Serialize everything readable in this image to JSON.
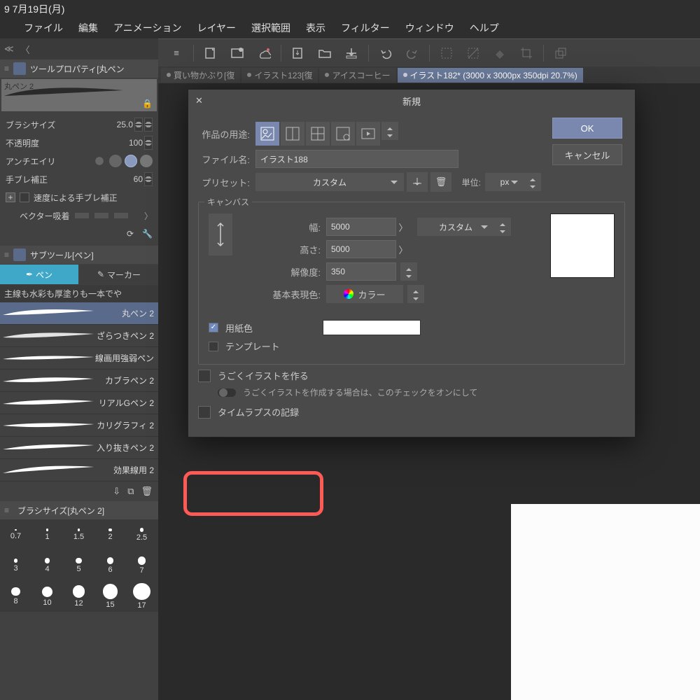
{
  "header_date": "9 7月19日(月)",
  "menu": [
    "ファイル",
    "編集",
    "アニメーション",
    "レイヤー",
    "選択範囲",
    "表示",
    "フィルター",
    "ウィンドウ",
    "ヘルプ"
  ],
  "tabs": [
    {
      "label": "買い物かぶり[復",
      "active": false
    },
    {
      "label": "イラスト123[復",
      "active": false
    },
    {
      "label": "アイスコーヒー",
      "active": false
    },
    {
      "label": "イラスト182* (3000 x 3000px 350dpi 20.7%)",
      "active": true
    }
  ],
  "tool_prop": {
    "title": "ツールプロパティ[丸ペン",
    "brush_name": "丸ペン 2",
    "rows": {
      "brush_size_label": "ブラシサイズ",
      "brush_size_val": "25.0",
      "opacity_label": "不透明度",
      "opacity_val": "100",
      "antialias_label": "アンチエイリ",
      "stabil_label": "手ブレ補正",
      "stabil_val": "60",
      "speed_stabil": "速度による手ブレ補正",
      "vector_snap": "ベクター吸着"
    }
  },
  "subtool": {
    "title": "サブツール[ペン]",
    "tabs": {
      "pen": "ペン",
      "marker": "マーカー"
    },
    "desc": "主線も水彩も厚塗りも一本でや",
    "brushes": [
      "丸ペン 2",
      "ざらつきペン 2",
      "線画用強弱ペン",
      "カブラペン 2",
      "リアルGペン 2",
      "カリグラフィ 2",
      "入り抜きペン 2",
      "効果線用 2"
    ]
  },
  "brush_size_panel": {
    "title": "ブラシサイズ[丸ペン 2]",
    "sizes": [
      0.7,
      1,
      1.5,
      2,
      2.5,
      3,
      4,
      5,
      6,
      7,
      8,
      10,
      12,
      15,
      17
    ]
  },
  "dialog": {
    "title": "新規",
    "ok": "OK",
    "cancel": "キャンセル",
    "purpose_label": "作品の用途:",
    "filename_label": "ファイル名:",
    "filename_val": "イラスト188",
    "preset_label": "プリセット:",
    "preset_val": "カスタム",
    "unit_label": "単位:",
    "unit_val": "px",
    "canvas_legend": "キャンバス",
    "width_label": "幅:",
    "width_val": "5000",
    "height_label": "高さ:",
    "height_val": "5000",
    "res_label": "解像度:",
    "res_val": "350",
    "colormode_label": "基本表現色:",
    "colormode_val": "カラー",
    "size_preset": "カスタム",
    "paper_color": "用紙色",
    "template": "テンプレート",
    "anim": "うごくイラストを作る",
    "anim_desc": "うごくイラストを作成する場合は、このチェックをオンにして",
    "timelapse": "タイムラプスの記録"
  }
}
